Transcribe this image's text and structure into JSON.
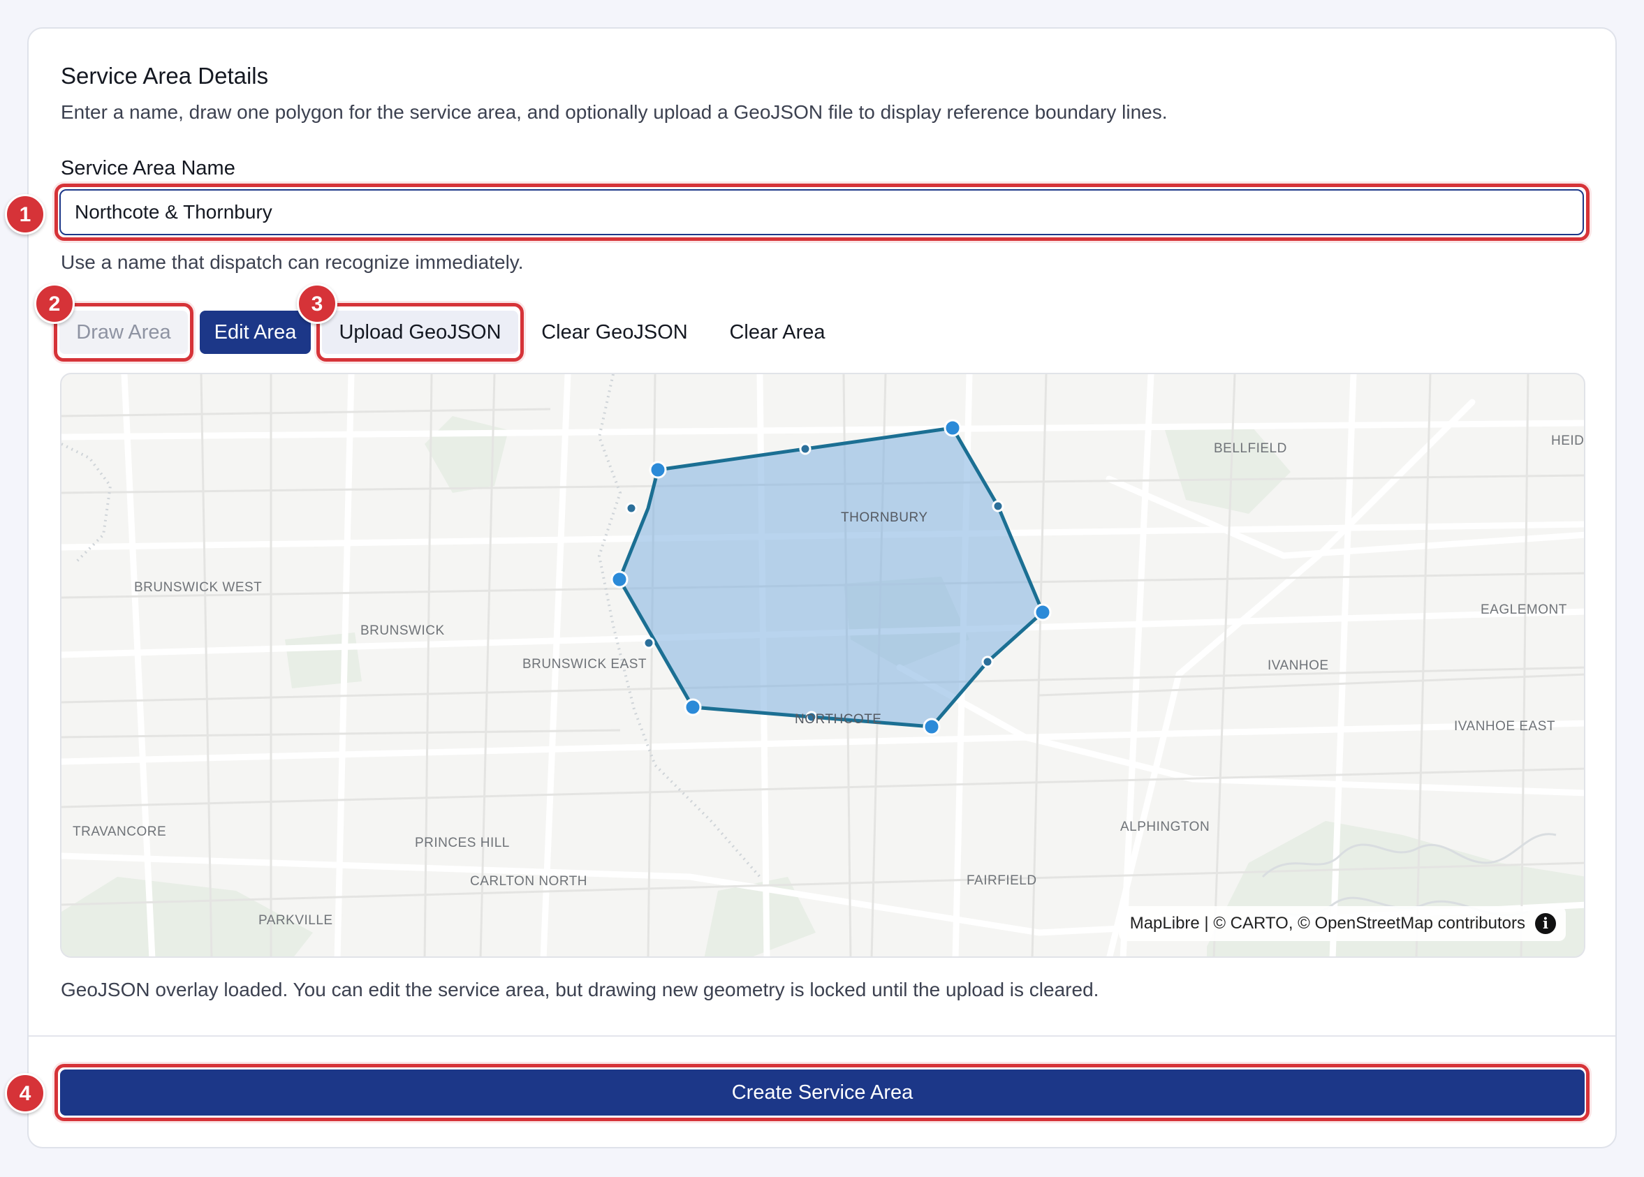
{
  "form": {
    "title": "Service Area Details",
    "description": "Enter a name, draw one polygon for the service area, and optionally upload a GeoJSON file to display reference boundary lines.",
    "name_label": "Service Area Name",
    "name_value": "Northcote & Thornbury",
    "name_hint": "Use a name that dispatch can recognize immediately.",
    "status_message": "GeoJSON overlay loaded. You can edit the service area, but drawing new geometry is locked until the upload is cleared.",
    "submit_label": "Create Service Area"
  },
  "toolbar": {
    "draw_label": "Draw Area",
    "edit_label": "Edit Area",
    "upload_label": "Upload GeoJSON",
    "clear_geojson_label": "Clear GeoJSON",
    "clear_area_label": "Clear Area"
  },
  "map": {
    "attribution": "MapLibre | © CARTO, © OpenStreetMap contributors",
    "info_glyph": "i",
    "places": {
      "bellfield": "BELLFIELD",
      "heid": "HEID",
      "thornbury": "THORNBURY",
      "brunswick_west": "BRUNSWICK WEST",
      "brunswick": "BRUNSWICK",
      "brunswick_east": "BRUNSWICK EAST",
      "eaglemont": "EAGLEMONT",
      "ivanhoe": "IVANHOE",
      "ivanhoe_east": "IVANHOE EAST",
      "northcote": "NORTHCOTE",
      "alphington": "ALPHINGTON",
      "travancore": "TRAVANCORE",
      "princes_hill": "PRINCES HILL",
      "carlton_north": "CARLTON NORTH",
      "fairfield": "FAIRFIELD",
      "parkville": "PARKVILLE"
    }
  },
  "annotations": [
    "1",
    "2",
    "3",
    "4"
  ],
  "colors": {
    "primary": "#1c3788",
    "highlight": "#d63338",
    "polygon_fill": "#7fb0e0",
    "polygon_stroke": "#1b6f93",
    "vertex": "#2b8ad8"
  }
}
